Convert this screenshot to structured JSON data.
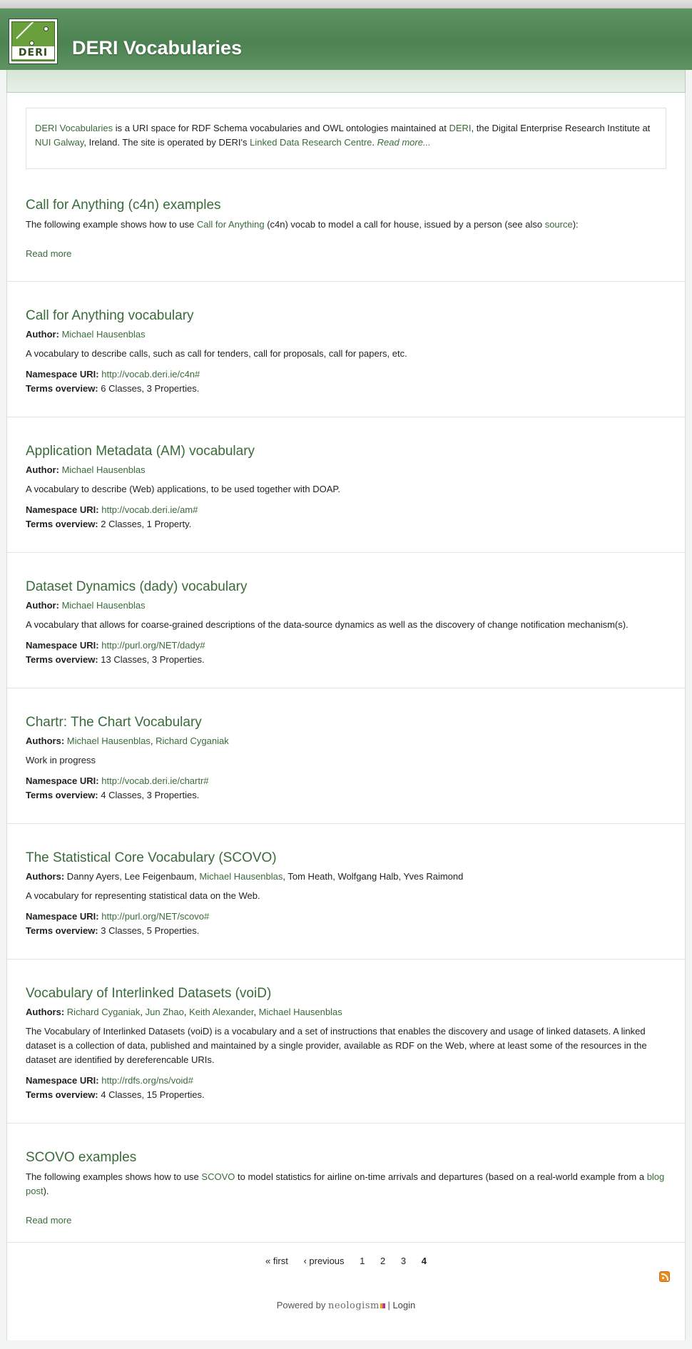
{
  "site": {
    "title": "DERI Vocabularies",
    "logo_text": "DERI"
  },
  "mission": {
    "deri_vocab_link": "DERI Vocabularies",
    "t1": " is a URI space for RDF Schema vocabularies and OWL ontologies maintained at ",
    "deri_link": "DERI",
    "t2": ", the Digital Enterprise Research Institute at ",
    "nui_link": "NUI Galway",
    "t3": ", Ireland. The site is operated by DERI's ",
    "ldrc_link": "Linked Data Research Centre",
    "t4": ". ",
    "read_more": "Read more..."
  },
  "labels": {
    "author": "Author:",
    "authors": "Authors:",
    "namespace": "Namespace URI:",
    "terms": "Terms overview:",
    "read_more": "Read more"
  },
  "nodes": [
    {
      "title": "Call for Anything (c4n) examples",
      "t1": "The following example shows how to use ",
      "link1": "Call for Anything",
      "t2": " (c4n) vocab to model a call for house, issued by a person (see also ",
      "link2": "source",
      "t3": "):"
    },
    {
      "title": "Call for Anything vocabulary",
      "author": "Michael Hausenblas",
      "description": "A vocabulary to describe calls, such as call for tenders, call for proposals, call for papers, etc.",
      "namespace": "http://vocab.deri.ie/c4n#",
      "classes": "6",
      "classes_label": "Classes",
      "props": "3",
      "props_label": "Properties"
    },
    {
      "title": "Application Metadata (AM) vocabulary",
      "author": "Michael Hausenblas",
      "description": "A vocabulary to describe (Web) applications, to be used together with DOAP.",
      "namespace": "http://vocab.deri.ie/am#",
      "classes": "2",
      "classes_label": "Classes",
      "props": "1",
      "props_label": "Property"
    },
    {
      "title": "Dataset Dynamics (dady) vocabulary",
      "author": "Michael Hausenblas",
      "description": "A vocabulary that allows for coarse-grained descriptions of the data-source dynamics as well as the discovery of change notification mechanism(s).",
      "namespace": "http://purl.org/NET/dady#",
      "classes": "13",
      "classes_label": "Classes",
      "props": "3",
      "props_label": "Properties"
    },
    {
      "title": "Chartr: The Chart Vocabulary",
      "author1": "Michael Hausenblas",
      "author2": "Richard Cyganiak",
      "description": "Work in progress",
      "namespace": "http://vocab.deri.ie/chartr#",
      "classes": "4",
      "classes_label": "Classes",
      "props": "3",
      "props_label": "Properties"
    },
    {
      "title": "The Statistical Core Vocabulary (SCOVO)",
      "a1": "Danny Ayers",
      "a2": "Lee Feigenbaum",
      "a3": "Michael Hausenblas",
      "a4": "Tom Heath",
      "a5": "Wolfgang Halb",
      "a6": "Yves Raimond",
      "description": "A vocabulary for representing statistical data on the Web.",
      "namespace": "http://purl.org/NET/scovo#",
      "classes": "3",
      "classes_label": "Classes",
      "props": "5",
      "props_label": "Properties"
    },
    {
      "title": "Vocabulary of Interlinked Datasets (voiD)",
      "a1": "Richard Cyganiak",
      "a2": "Jun Zhao",
      "a3": "Keith Alexander",
      "a4": "Michael Hausenblas",
      "description": "The Vocabulary of Interlinked Datasets (voiD) is a vocabulary and a set of instructions that enables the discovery and usage of linked datasets. A linked dataset is a collection of data, published and maintained by a single provider, available as RDF on the Web, where at least some of the resources in the dataset are identified by dereferencable URIs.",
      "namespace": "http://rdfs.org/ns/void#",
      "classes": "4",
      "classes_label": "Classes",
      "props": "15",
      "props_label": "Properties"
    },
    {
      "title": "SCOVO examples",
      "t1": "The following examples shows how to use ",
      "link1": "SCOVO",
      "t2": " to model statistics for airline on-time arrivals and departures (based on a real-world example from a ",
      "link2": "blog post",
      "t3": ")."
    }
  ],
  "pager": {
    "first": "« first",
    "previous": "‹ previous",
    "p1": "1",
    "p2": "2",
    "p3": "3",
    "p4": "4"
  },
  "footer": {
    "powered_by": "Powered by ",
    "brand": "neologism",
    "sep": " | ",
    "login": "Login"
  },
  "icons": {
    "feed": "rss-feed-icon"
  }
}
